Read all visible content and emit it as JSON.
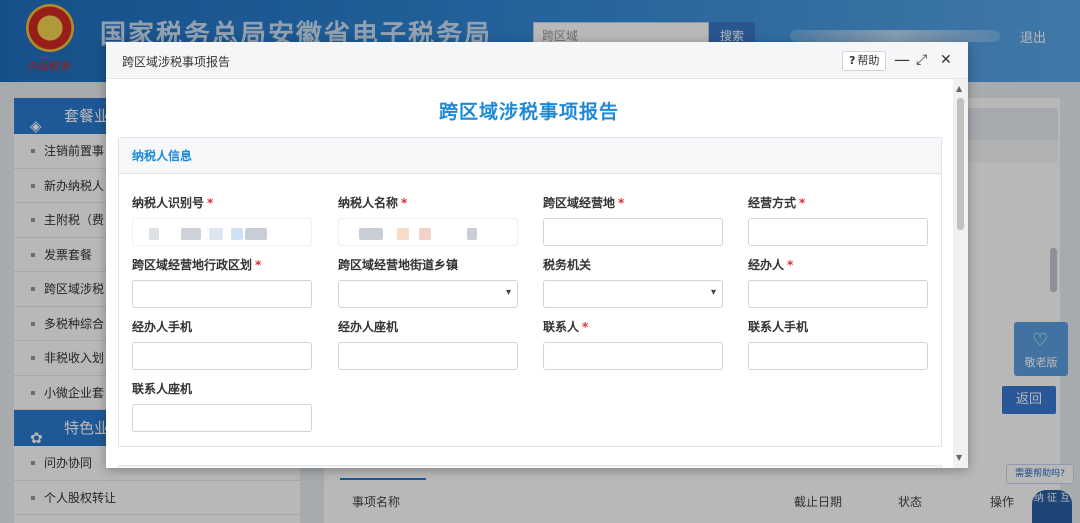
{
  "header": {
    "site_title": "国家税务总局安徽省电子税务局",
    "emblem_sub": "中国税务",
    "search_placeholder": "跨区域",
    "search_button": "搜索",
    "logout": "退出"
  },
  "sidebar": {
    "section1": "套餐业",
    "items": [
      "注销前置事",
      "新办纳税人",
      "主附税（费",
      "发票套餐",
      "跨区域涉税",
      "多税种综合",
      "非税收入划",
      "小微企业套"
    ],
    "section2": "特色业",
    "items2": [
      "问办协同",
      "个人股权转让"
    ]
  },
  "main": {
    "back_button": "返回",
    "elder_mode": "敬老版",
    "help_bubble": "需要帮助吗?",
    "mascot": "纳 征 互",
    "table_headers": [
      "事项名称",
      "截止日期",
      "状态",
      "操作"
    ]
  },
  "modal": {
    "title": "跨区域涉税事项报告",
    "help_label": "帮助",
    "controls": {
      "minimize": "—",
      "maximize": "⤢",
      "close": "✕"
    },
    "report_title": "跨区域涉税事项报告",
    "panel_title": "纳税人信息",
    "fields": [
      {
        "label": "纳税人识别号",
        "required": "*",
        "type": "readonly",
        "value": ""
      },
      {
        "label": "纳税人名称",
        "required": "*",
        "type": "readonly",
        "value": ""
      },
      {
        "label": "跨区域经营地",
        "required": "*",
        "type": "input",
        "value": ""
      },
      {
        "label": "经营方式",
        "required": "*",
        "type": "input",
        "value": ""
      },
      {
        "label": "跨区域经营地行政区划",
        "required": "*",
        "type": "input",
        "value": ""
      },
      {
        "label": "跨区域经营地街道乡镇",
        "required": "",
        "type": "select",
        "value": ""
      },
      {
        "label": "税务机关",
        "required": "",
        "type": "select",
        "value": ""
      },
      {
        "label": "经办人",
        "required": "*",
        "type": "input",
        "value": ""
      },
      {
        "label": "经办人手机",
        "required": "",
        "type": "input",
        "value": ""
      },
      {
        "label": "经办人座机",
        "required": "",
        "type": "input",
        "value": ""
      },
      {
        "label": "联系人",
        "required": "*",
        "type": "input",
        "value": ""
      },
      {
        "label": "联系人手机",
        "required": "",
        "type": "input",
        "value": ""
      },
      {
        "label": "联系人座机",
        "required": "",
        "type": "input",
        "value": ""
      }
    ]
  }
}
